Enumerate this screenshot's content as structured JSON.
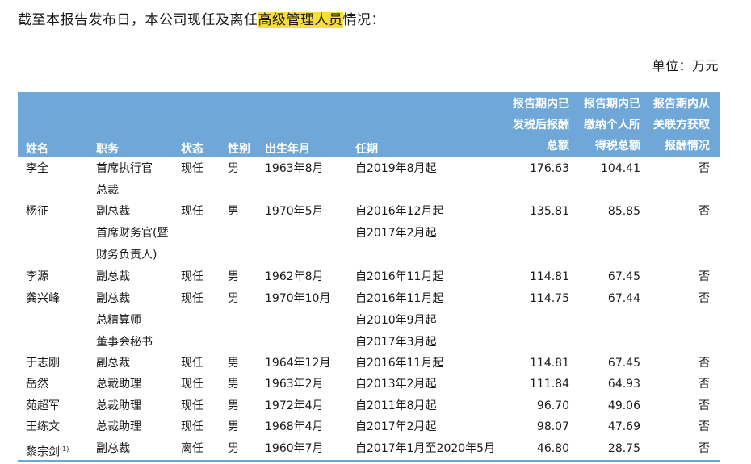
{
  "intro": {
    "prefix": "截至本报告发布日，本公司现任及离任",
    "highlight": "高级管理人员",
    "suffix": "情况："
  },
  "unit_label": "单位：万元",
  "table": {
    "headers": {
      "name": "姓名",
      "position": "职务",
      "status": "状态",
      "gender": "性别",
      "birth": "出生年月",
      "term": "任期",
      "after_tax": [
        "报告期内已",
        "发税后报酬",
        "总额"
      ],
      "tax_paid": [
        "报告期内已",
        "缴纳个人所",
        "得税总额"
      ],
      "related": [
        "报告期内从",
        "关联方获取",
        "报酬情况"
      ]
    },
    "rows": [
      {
        "name": "李全",
        "name_sup": "",
        "positions": [
          "首席执行官",
          "总裁"
        ],
        "status": "现任",
        "gender": "男",
        "birth": "1963年8月",
        "terms": [
          "自2019年8月起"
        ],
        "after_tax": "176.63",
        "tax_paid": "104.41",
        "related": "否"
      },
      {
        "name": "杨征",
        "name_sup": "",
        "positions": [
          "副总裁",
          "首席财务官(暨",
          " 财务负责人)"
        ],
        "status": "现任",
        "gender": "男",
        "birth": "1970年5月",
        "terms": [
          "自2016年12月起",
          "自2017年2月起"
        ],
        "after_tax": "135.81",
        "tax_paid": "85.85",
        "related": "否"
      },
      {
        "name": "李源",
        "name_sup": "",
        "positions": [
          "副总裁"
        ],
        "status": "现任",
        "gender": "男",
        "birth": "1962年8月",
        "terms": [
          "自2016年11月起"
        ],
        "after_tax": "114.81",
        "tax_paid": "67.45",
        "related": "否"
      },
      {
        "name": "龚兴峰",
        "name_sup": "",
        "positions": [
          "副总裁",
          "总精算师",
          "董事会秘书"
        ],
        "status": "现任",
        "gender": "男",
        "birth": "1970年10月",
        "terms": [
          "自2016年11月起",
          "自2010年9月起",
          "自2017年3月起"
        ],
        "after_tax": "114.75",
        "tax_paid": "67.44",
        "related": "否"
      },
      {
        "name": "于志刚",
        "name_sup": "",
        "positions": [
          "副总裁"
        ],
        "status": "现任",
        "gender": "男",
        "birth": "1964年12月",
        "terms": [
          "自2016年11月起"
        ],
        "after_tax": "114.81",
        "tax_paid": "67.45",
        "related": "否"
      },
      {
        "name": "岳然",
        "name_sup": "",
        "positions": [
          "总裁助理"
        ],
        "status": "现任",
        "gender": "男",
        "birth": "1963年2月",
        "terms": [
          "自2013年2月起"
        ],
        "after_tax": "111.84",
        "tax_paid": "64.93",
        "related": "否"
      },
      {
        "name": "苑超军",
        "name_sup": "",
        "positions": [
          "总裁助理"
        ],
        "status": "现任",
        "gender": "男",
        "birth": "1972年4月",
        "terms": [
          "自2011年8月起"
        ],
        "after_tax": "96.70",
        "tax_paid": "49.06",
        "related": "否"
      },
      {
        "name": "王练文",
        "name_sup": "",
        "positions": [
          "总裁助理"
        ],
        "status": "现任",
        "gender": "男",
        "birth": "1968年4月",
        "terms": [
          "自2017年2月起"
        ],
        "after_tax": "98.07",
        "tax_paid": "47.69",
        "related": "否"
      },
      {
        "name": "黎宗剑",
        "name_sup": "(1)",
        "positions": [
          "副总裁"
        ],
        "status": "离任",
        "gender": "男",
        "birth": "1960年7月",
        "terms": [
          "自2017年1月至2020年5月"
        ],
        "after_tax": "46.80",
        "tax_paid": "28.75",
        "related": "否"
      }
    ]
  }
}
